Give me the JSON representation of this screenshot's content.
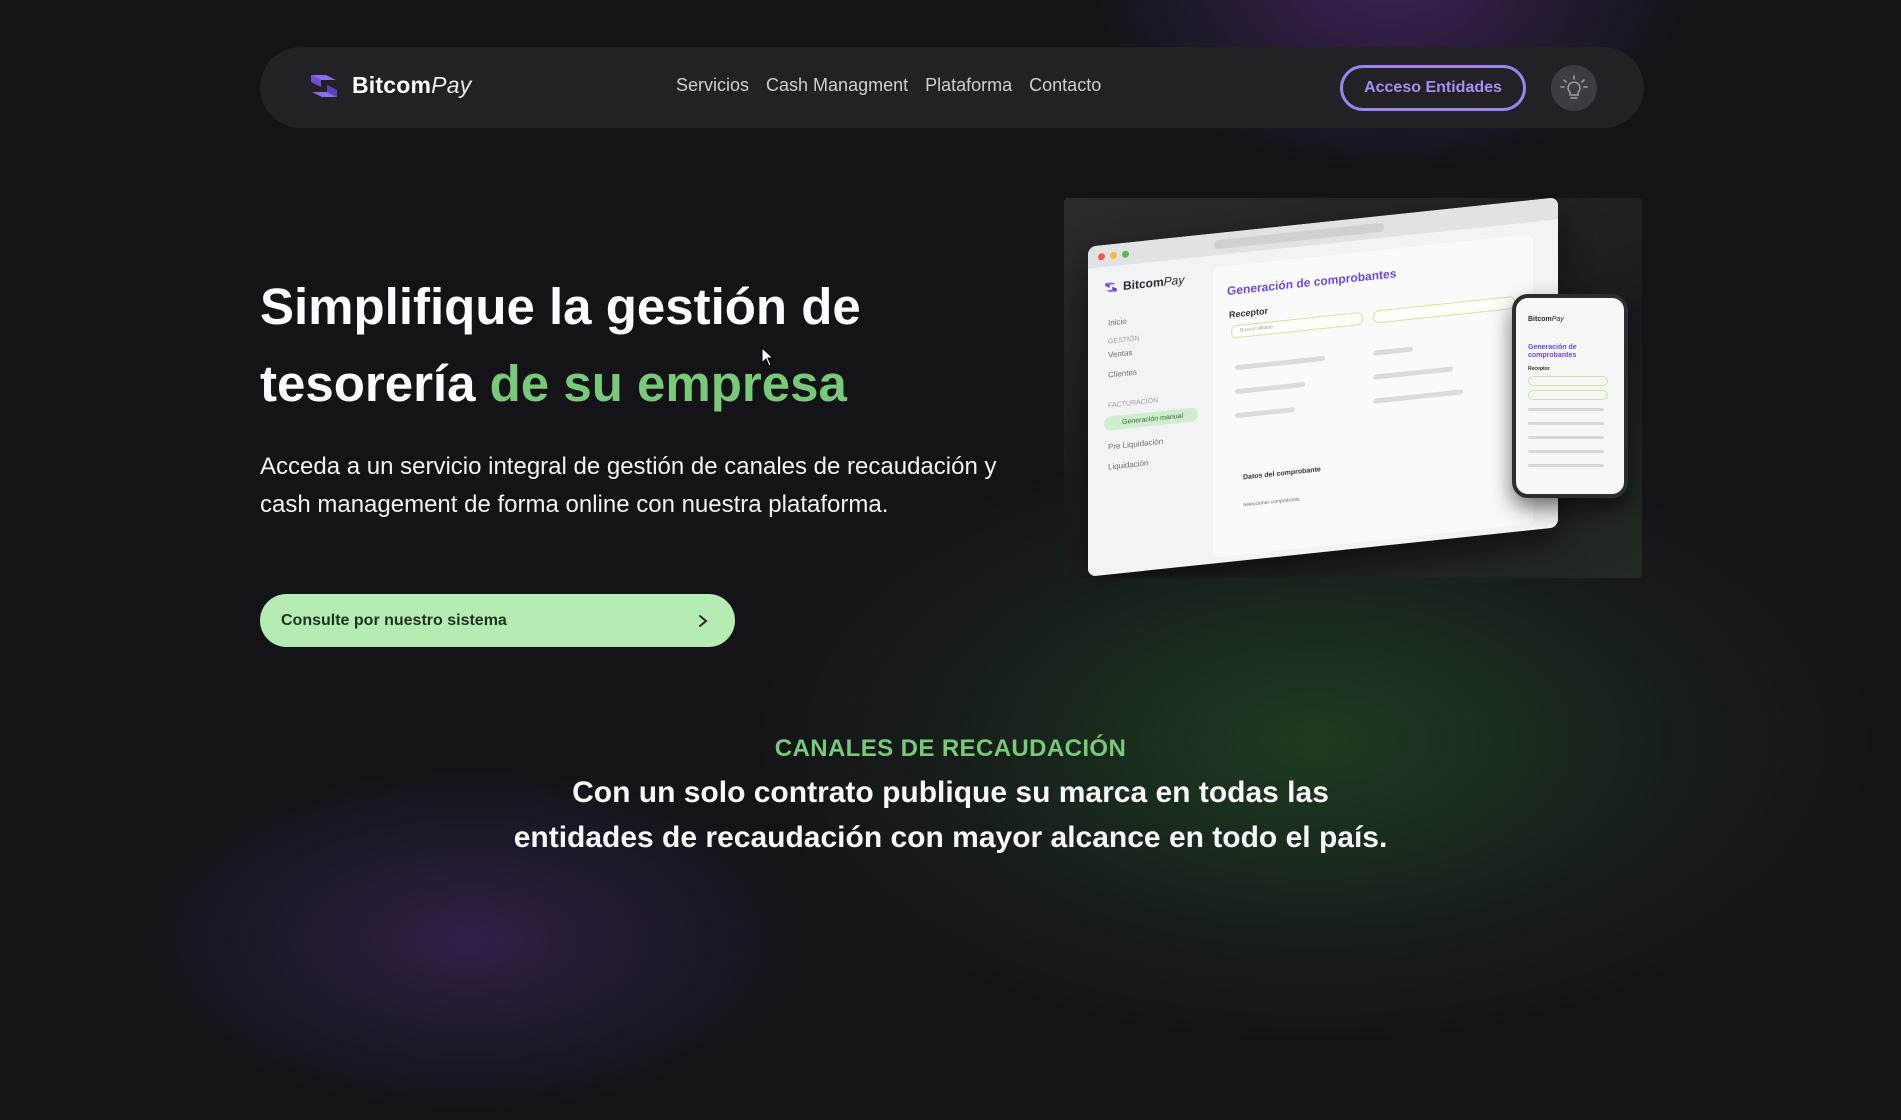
{
  "nav": {
    "brand": {
      "bold": "Bitcom",
      "italic": "Pay"
    },
    "links": [
      "Servicios",
      "Cash Managment",
      "Plataforma",
      "Contacto"
    ],
    "access_button": "Acceso Entidades",
    "theme_toggle_icon": "lightbulb-icon"
  },
  "hero": {
    "title_main": "Simplifique la gestión de tesorería",
    "title_accent": "de su empresa",
    "subtitle": "Acceda a un servicio integral de gestión de canales de recaudación y cash management de forma online con nuestra plataforma.",
    "cta_label": "Consulte por nuestro sistema",
    "cta_icon": "chevron-right-icon"
  },
  "mockup": {
    "laptop": {
      "brand": {
        "bold": "Bitcom",
        "italic": "Pay"
      },
      "menu": {
        "home": "Inicio",
        "section_gestion": "GESTIÓN",
        "ventas": "Ventas",
        "clientes": "Clientes",
        "section_facturacion": "FACTURACIÓN",
        "active": "Generación manual",
        "pre_liquidacion": "Pre Liquidación",
        "liquidacion": "Liquidación"
      },
      "page_title": "Generación de comprobantes",
      "receptor_label": "Receptor",
      "search_placeholder": "Buscar afiliado",
      "datos_label": "Datos del comprobante",
      "tipo_placeholder": "Seleccionar comprobante"
    },
    "phone": {
      "brand": {
        "bold": "Bitcom",
        "italic": "Pay"
      },
      "page_title": "Generación de comprobantes",
      "receptor_label": "Receptor"
    }
  },
  "canales": {
    "kicker": "CANALES DE RECAUDACIÓN",
    "title": "Con un solo contrato publique su marca en todas las entidades de recaudación con mayor alcance en todo el país."
  },
  "colors": {
    "background": "#141317",
    "accent_green": "#79c97a",
    "accent_purple": "#9d82f0",
    "cta_bg": "#b5ecb3"
  }
}
